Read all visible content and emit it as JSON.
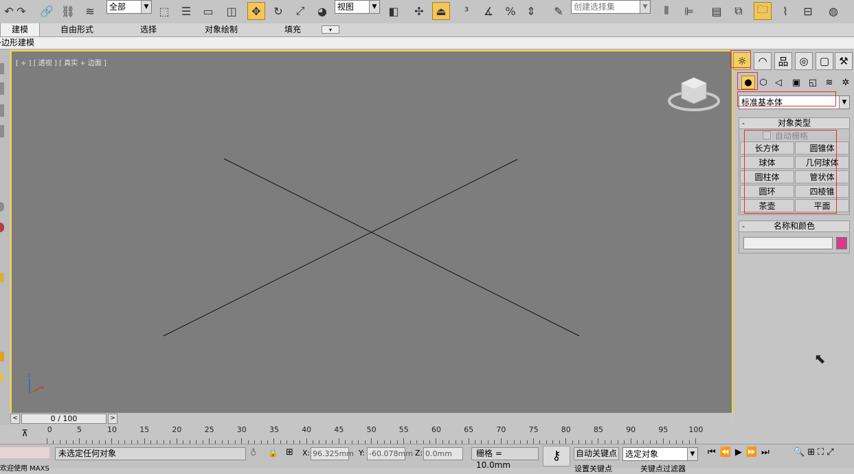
{
  "toolbar": {
    "selection_filter": "全部",
    "reference_coord": "视图",
    "named_selection": "创建选择集"
  },
  "ribbon": {
    "tabs": [
      "建模",
      "自由形式",
      "选择",
      "对象绘制",
      "填充"
    ],
    "active_tab": "建模",
    "sub_label": "多边形建模"
  },
  "viewport": {
    "label": "[ + ] [ 透视 ] [ 真实 + 边面 ]"
  },
  "command_panel": {
    "category_dropdown": "标准基本体",
    "object_type_title": "对象类型",
    "autogrid_label": "自动栅格",
    "object_buttons": [
      "长方体",
      "圆锥体",
      "球体",
      "几何球体",
      "圆柱体",
      "管状体",
      "圆环",
      "四棱锥",
      "茶壶",
      "平面"
    ],
    "name_color_title": "名称和颜色",
    "object_color": "#d53a8c"
  },
  "timeline": {
    "frame_display": "0 / 100",
    "tick_labels": [
      "0",
      "5",
      "10",
      "15",
      "20",
      "25",
      "30",
      "35",
      "40",
      "45",
      "50",
      "55",
      "60",
      "65",
      "70",
      "75",
      "80",
      "85",
      "90",
      "95",
      "100"
    ]
  },
  "status": {
    "selection_text": "未选定任何对象",
    "x_label": "X:",
    "x_value": "96.325mm",
    "y_label": "Y:",
    "y_value": "-60.078mm",
    "z_label": "Z:",
    "z_value": "0.0mm",
    "grid_text": "栅格 = 10.0mm",
    "auto_key": "自动关键点",
    "selected_object": "选定对象",
    "maxscript_hint": "欢迎使用 MAXS",
    "set_key_partial": "设置关键点",
    "key_filters_partial": "关键点过滤器"
  }
}
